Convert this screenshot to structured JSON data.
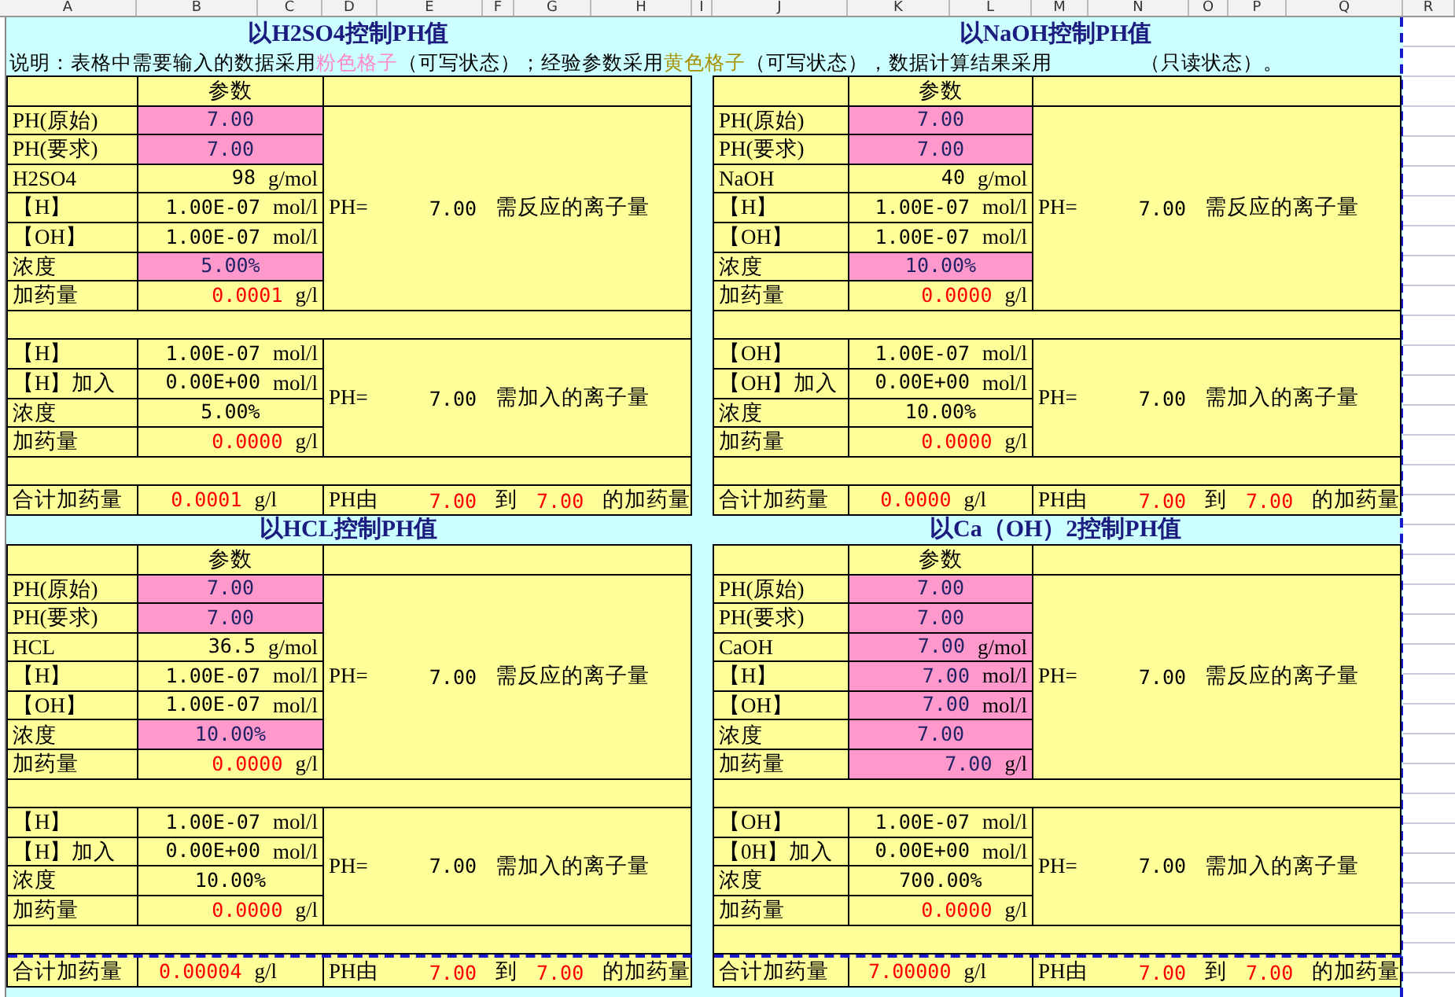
{
  "column_headers": [
    "A",
    "B",
    "C",
    "D",
    "E",
    "F",
    "G",
    "H",
    "I",
    "J",
    "K",
    "L",
    "M",
    "N",
    "O",
    "P",
    "Q",
    "R"
  ],
  "explanation": [
    {
      "text": "说明：表格中需要输入的数据采用",
      "kind": "plain"
    },
    {
      "text": "粉色格子",
      "kind": "pink"
    },
    {
      "text": "（可写状态）；经验参数采用",
      "kind": "plain"
    },
    {
      "text": "黄色格子",
      "kind": "yellow"
    },
    {
      "text": "（可写状态），数据计算结果采用",
      "kind": "plain"
    },
    {
      "text": "（只读状态）。",
      "kind": "gap"
    }
  ],
  "blocks": [
    {
      "title": "以H2SO4控制PH值",
      "header": "参数",
      "reaction_rows": [
        {
          "label": "PH(原始)",
          "value": "7.00",
          "kind": "input"
        },
        {
          "label": "PH(要求)",
          "value": "7.00",
          "kind": "input"
        },
        {
          "label": "H2SO4",
          "value": "98",
          "unit": "g/mol",
          "kind": "constant"
        },
        {
          "label": "【H】",
          "value": "1.00E-07",
          "unit": "mol/l",
          "kind": "constant"
        },
        {
          "label": "【OH】",
          "value": "1.00E-07",
          "unit": "mol/l",
          "kind": "constant"
        },
        {
          "label": "浓度",
          "value": "5.00%",
          "kind": "input"
        },
        {
          "label": "加药量",
          "value": "0.0001",
          "unit": "g/l",
          "kind": "result"
        }
      ],
      "reaction_summary": {
        "label": "PH=",
        "value": "7.00",
        "text": "需反应的离子量"
      },
      "addition_rows": [
        {
          "label": "【H】",
          "value": "1.00E-07",
          "unit": "mol/l",
          "kind": "constant"
        },
        {
          "label": "【H】加入",
          "value": "0.00E+00",
          "unit": "mol/l",
          "kind": "constant"
        },
        {
          "label": "浓度",
          "value": "5.00%",
          "kind": "constant"
        },
        {
          "label": "加药量",
          "value": "0.0000",
          "unit": "g/l",
          "kind": "result"
        }
      ],
      "addition_summary": {
        "label": "PH=",
        "value": "7.00",
        "text": "需加入的离子量"
      },
      "total": {
        "label": "合计加药量",
        "value": "0.0001",
        "unit": "g/l",
        "ph_label": "PH由",
        "from": "7.00",
        "to_label": "到",
        "to": "7.00",
        "suffix": "的加药量"
      }
    },
    {
      "title": "以NaOH控制PH值",
      "header": "参数",
      "reaction_rows": [
        {
          "label": "PH(原始)",
          "value": "7.00",
          "kind": "input"
        },
        {
          "label": "PH(要求)",
          "value": "7.00",
          "kind": "input"
        },
        {
          "label": "NaOH",
          "value": "40",
          "unit": "g/mol",
          "kind": "constant"
        },
        {
          "label": "【H】",
          "value": "1.00E-07",
          "unit": "mol/l",
          "kind": "constant"
        },
        {
          "label": "【OH】",
          "value": "1.00E-07",
          "unit": "mol/l",
          "kind": "constant"
        },
        {
          "label": "浓度",
          "value": "10.00%",
          "kind": "input"
        },
        {
          "label": "加药量",
          "value": "0.0000",
          "unit": "g/l",
          "kind": "result"
        }
      ],
      "reaction_summary": {
        "label": "PH=",
        "value": "7.00",
        "text": "需反应的离子量"
      },
      "addition_rows": [
        {
          "label": "【OH】",
          "value": "1.00E-07",
          "unit": "mol/l",
          "kind": "constant"
        },
        {
          "label": "【OH】加入",
          "value": "0.00E+00",
          "unit": "mol/l",
          "kind": "constant"
        },
        {
          "label": "浓度",
          "value": "10.00%",
          "kind": "constant"
        },
        {
          "label": "加药量",
          "value": "0.0000",
          "unit": "g/l",
          "kind": "result"
        }
      ],
      "addition_summary": {
        "label": "PH=",
        "value": "7.00",
        "text": "需加入的离子量"
      },
      "total": {
        "label": "合计加药量",
        "value": "0.0000",
        "unit": "g/l",
        "ph_label": "PH由",
        "from": "7.00",
        "to_label": "到",
        "to": "7.00",
        "suffix": "的加药量"
      }
    },
    {
      "title": "以HCL控制PH值",
      "header": "参数",
      "reaction_rows": [
        {
          "label": "PH(原始)",
          "value": "7.00",
          "kind": "input"
        },
        {
          "label": "PH(要求)",
          "value": "7.00",
          "kind": "input"
        },
        {
          "label": "HCL",
          "value": "36.5",
          "unit": "g/mol",
          "kind": "constant"
        },
        {
          "label": "【H】",
          "value": "1.00E-07",
          "unit": "mol/l",
          "kind": "constant"
        },
        {
          "label": "【OH】",
          "value": "1.00E-07",
          "unit": "mol/l",
          "kind": "constant"
        },
        {
          "label": "浓度",
          "value": "10.00%",
          "kind": "input"
        },
        {
          "label": "加药量",
          "value": "0.0000",
          "unit": "g/l",
          "kind": "result"
        }
      ],
      "reaction_summary": {
        "label": "PH=",
        "value": "7.00",
        "text": "需反应的离子量"
      },
      "addition_rows": [
        {
          "label": "【H】",
          "value": "1.00E-07",
          "unit": "mol/l",
          "kind": "constant"
        },
        {
          "label": "【H】加入",
          "value": "0.00E+00",
          "unit": "mol/l",
          "kind": "constant"
        },
        {
          "label": "浓度",
          "value": "10.00%",
          "kind": "constant"
        },
        {
          "label": "加药量",
          "value": "0.0000",
          "unit": "g/l",
          "kind": "result"
        }
      ],
      "addition_summary": {
        "label": "PH=",
        "value": "7.00",
        "text": "需加入的离子量"
      },
      "total": {
        "label": "合计加药量",
        "value": "0.00004",
        "unit": "g/l",
        "ph_label": "PH由",
        "from": "7.00",
        "to_label": "到",
        "to": "7.00",
        "suffix": "的加药量"
      }
    },
    {
      "title": "以Ca（OH）2控制PH值",
      "header": "参数",
      "reaction_rows": [
        {
          "label": "PH(原始)",
          "value": "7.00",
          "kind": "input"
        },
        {
          "label": "PH(要求)",
          "value": "7.00",
          "kind": "input"
        },
        {
          "label": "CaOH",
          "value": "7.00",
          "unit": "g/mol",
          "kind": "input"
        },
        {
          "label": "【H】",
          "value": "7.00",
          "unit": "mol/l",
          "kind": "input"
        },
        {
          "label": "【OH】",
          "value": "7.00",
          "unit": "mol/l",
          "kind": "input"
        },
        {
          "label": "浓度",
          "value": "7.00",
          "kind": "input"
        },
        {
          "label": "加药量",
          "value": "7.00",
          "unit": "g/l",
          "kind": "input"
        }
      ],
      "reaction_summary": {
        "label": "PH=",
        "value": "7.00",
        "text": "需反应的离子量"
      },
      "addition_rows": [
        {
          "label": "【OH】",
          "value": "1.00E-07",
          "unit": "mol/l",
          "kind": "constant"
        },
        {
          "label": "【0H】加入",
          "value": "0.00E+00",
          "unit": "mol/l",
          "kind": "constant"
        },
        {
          "label": "浓度",
          "value": "700.00%",
          "kind": "constant"
        },
        {
          "label": "加药量",
          "value": "0.0000",
          "unit": "g/l",
          "kind": "result"
        }
      ],
      "addition_summary": {
        "label": "PH=",
        "value": "7.00",
        "text": "需加入的离子量"
      },
      "total": {
        "label": "合计加药量",
        "value": "7.00000",
        "unit": "g/l",
        "ph_label": "PH由",
        "from": "7.00",
        "to_label": "到",
        "to": "7.00",
        "suffix": "的加药量"
      }
    }
  ]
}
